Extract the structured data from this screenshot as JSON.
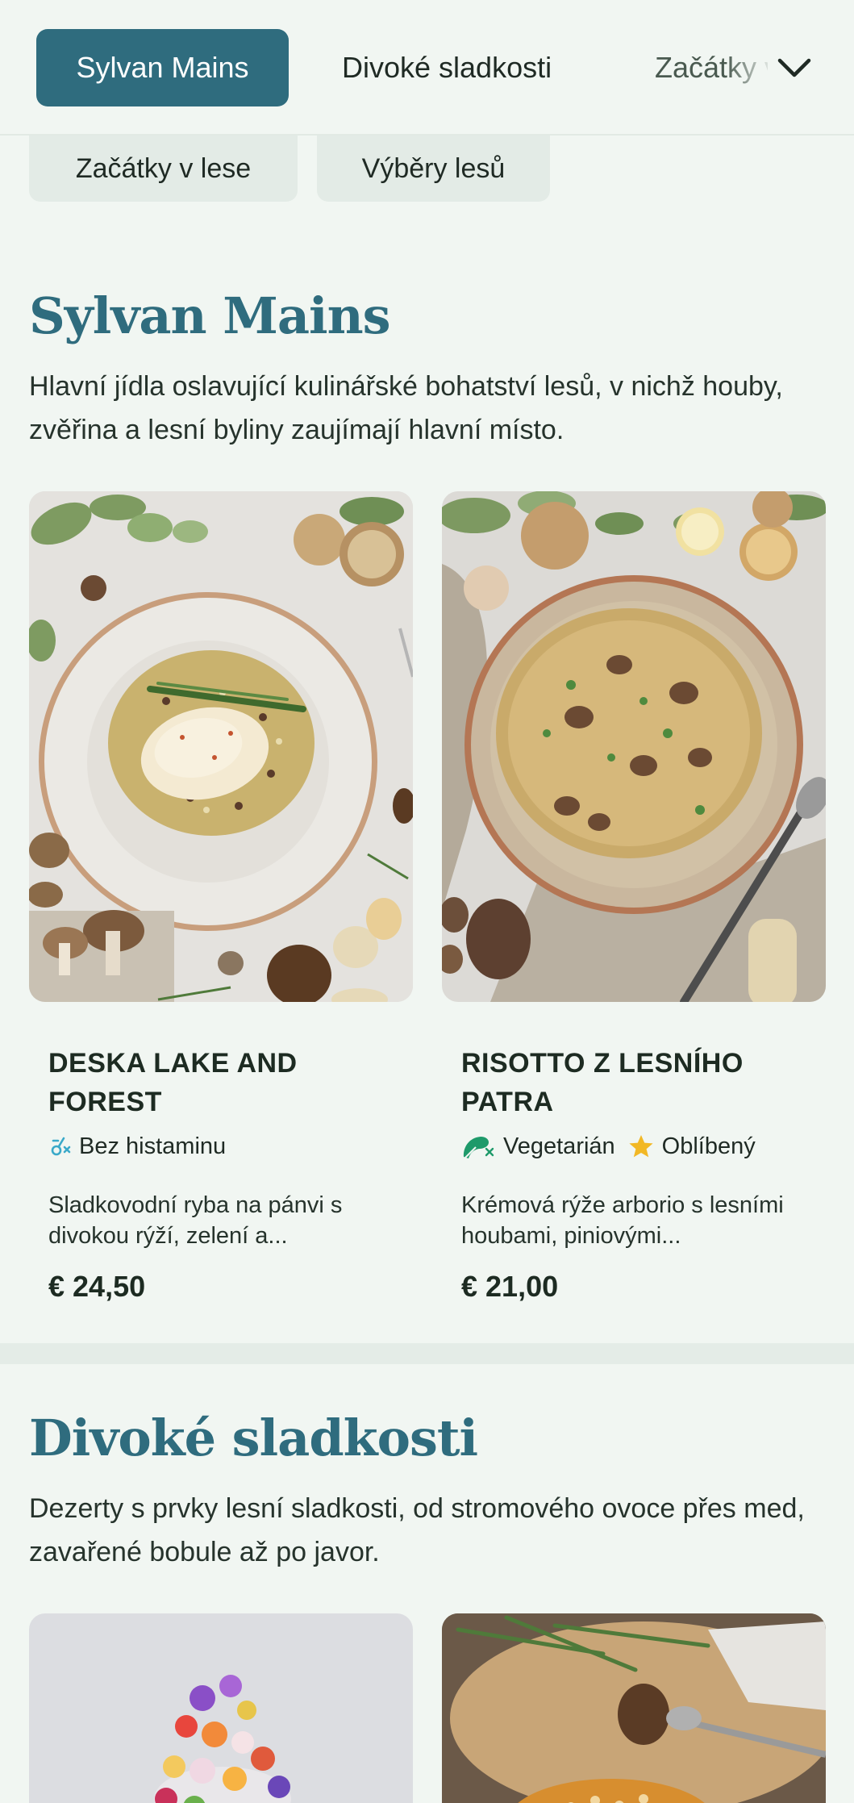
{
  "nav": {
    "tabs": [
      {
        "label": "Sylvan Mains",
        "active": true
      },
      {
        "label": "Divoké sladkosti",
        "active": false
      },
      {
        "label": "Začátky v lese",
        "active": false
      }
    ],
    "expand_icon": "chevron-down-icon",
    "chips": [
      "Začátky v lese",
      "Výběry lesů"
    ]
  },
  "sections": [
    {
      "title": "Sylvan Mains",
      "description": "Hlavní jídla oslavující kulinářské bohatství lesů, v nichž houby, zvěřina a lesní byliny zaujímají hlavní místo.",
      "items": [
        {
          "name": "DESKA LAKE AND FOREST",
          "tags": [
            {
              "icon": "histamine-free-icon",
              "label": "Bez histaminu"
            }
          ],
          "description": "Sladkovodní ryba na pánvi s divokou rýží, zelení a...",
          "price": "€ 24,50"
        },
        {
          "name": "RISOTTO Z LESNÍHO PATRA",
          "tags": [
            {
              "icon": "vegetarian-icon",
              "label": "Vegetarián"
            },
            {
              "icon": "star-icon",
              "label": "Oblíbený"
            }
          ],
          "description": "Krémová rýže arborio s lesními houbami, piniovými...",
          "price": "€ 21,00"
        }
      ]
    },
    {
      "title": "Divoké sladkosti",
      "description": "Dezerty s prvky lesní sladkosti, od stromového ovoce přes med, zavařené bobule až po javor."
    }
  ],
  "colors": {
    "accent": "#2f6c7e",
    "background": "#f1f6f2",
    "chip": "#e3ebe6",
    "vegetarian": "#1e9a6a",
    "star": "#f2b825",
    "histamine": "#3aa9c9"
  }
}
